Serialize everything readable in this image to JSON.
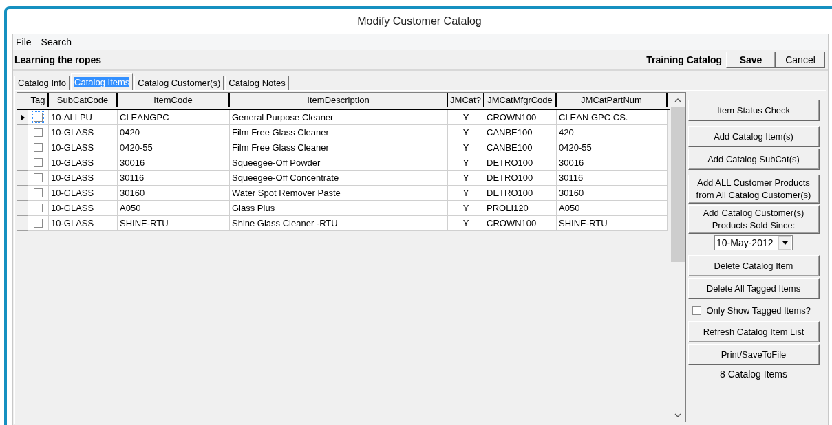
{
  "window": {
    "title": "Modify Customer Catalog"
  },
  "menu": [
    {
      "label": "File"
    },
    {
      "label": "Search"
    }
  ],
  "header": {
    "catalog_name": "Learning the ropes",
    "catalog_type": "Training Catalog",
    "buttons": [
      {
        "label": "Save",
        "bold": true
      },
      {
        "label": "Cancel",
        "bold": false
      }
    ]
  },
  "tabs": [
    {
      "label": "Catalog Info",
      "selected": false
    },
    {
      "label": "Catalog Items",
      "selected": true
    },
    {
      "label": "Catalog Customer(s)",
      "selected": false
    },
    {
      "label": "Catalog Notes",
      "selected": false
    }
  ],
  "table": {
    "tag_column": "Tag",
    "columns": [
      "SubCatCode",
      "ItemCode",
      "ItemDescription",
      "JMCat?",
      "JMCatMfgrCode",
      "JMCatPartNum"
    ],
    "rows": [
      {
        "current": true,
        "tagged": false,
        "cells": [
          "10-ALLPU",
          "CLEANGPC",
          "General Purpose Cleaner",
          "Y",
          "CROWN100",
          "CLEAN GPC CS."
        ]
      },
      {
        "current": false,
        "tagged": false,
        "cells": [
          "10-GLASS",
          "0420",
          "Film Free Glass Cleaner",
          "Y",
          "CANBE100",
          "420"
        ]
      },
      {
        "current": false,
        "tagged": false,
        "cells": [
          "10-GLASS",
          "0420-55",
          "Film Free Glass Cleaner",
          "Y",
          "CANBE100",
          "0420-55"
        ]
      },
      {
        "current": false,
        "tagged": false,
        "cells": [
          "10-GLASS",
          "30016",
          "Squeegee-Off Powder",
          "Y",
          "DETRO100",
          "30016"
        ]
      },
      {
        "current": false,
        "tagged": false,
        "cells": [
          "10-GLASS",
          "30116",
          "Squeegee-Off Concentrate",
          "Y",
          "DETRO100",
          "30116"
        ]
      },
      {
        "current": false,
        "tagged": false,
        "cells": [
          "10-GLASS",
          "30160",
          "Water Spot Remover Paste",
          "Y",
          "DETRO100",
          "30160"
        ]
      },
      {
        "current": false,
        "tagged": false,
        "cells": [
          "10-GLASS",
          "A050",
          "Glass Plus",
          "Y",
          "PROLI120",
          "A050"
        ]
      },
      {
        "current": false,
        "tagged": false,
        "cells": [
          "10-GLASS",
          "SHINE-RTU",
          "Shine Glass Cleaner -RTU",
          "Y",
          "CROWN100",
          "SHINE-RTU"
        ]
      }
    ]
  },
  "side_panel": [
    [
      {
        "kind": "button",
        "label": "Item Status Check"
      }
    ],
    [
      {
        "kind": "button",
        "label": "Add Catalog Item(s)"
      },
      {
        "kind": "button",
        "label": "Add Catalog SubCat(s)"
      }
    ],
    [
      {
        "kind": "button",
        "label": "Add ALL Customer Products\nfrom All Catalog Customer(s)"
      },
      {
        "kind": "button",
        "label": "Add Catalog Customer(s)\nProducts Sold Since:"
      },
      {
        "kind": "date",
        "value": "10-May-2012"
      }
    ],
    [
      {
        "kind": "button",
        "label": "Delete Catalog Item"
      },
      {
        "kind": "button",
        "label": "Delete All Tagged Items"
      },
      {
        "kind": "checkbox",
        "label": "Only Show Tagged Items?",
        "checked": false
      },
      {
        "kind": "button",
        "label": "Refresh Catalog Item List"
      },
      {
        "kind": "button",
        "label": "Print/SaveToFile"
      },
      {
        "kind": "count",
        "label": "8 Catalog Items"
      }
    ]
  ]
}
